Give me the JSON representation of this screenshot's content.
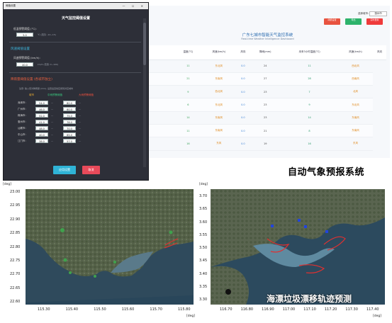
{
  "dashboard": {
    "city_select": {
      "label": "选择城市:",
      "value": "惠州市"
    },
    "buttons": [
      {
        "label": "阈值设置",
        "color": "#e8533f"
      },
      {
        "label": "导出",
        "color": "#2db36b"
      },
      {
        "label": "实时更新",
        "color": "#ef3b3b"
      }
    ],
    "title": "广东七城市智能天气监控系统",
    "subtitle": "Real-time Weather Intelligence Dashboard",
    "columns": [
      "温度(°C)",
      "风速(km/h)",
      "风向",
      "降雨(mm)",
      "未来3小时温度(°C)",
      "风速(km/h)",
      "风向"
    ],
    "rows": [
      [
        "",
        "11",
        "东北风",
        "0.0",
        "24",
        "11",
        "西北风"
      ],
      [
        "",
        "21",
        "东南风",
        "0.0",
        "27",
        "28",
        "西南风"
      ],
      [
        "",
        "9",
        "西北风",
        "0.0",
        "23",
        "7",
        "北风"
      ],
      [
        "",
        "6",
        "东北风",
        "0.0",
        "23",
        "9",
        "东北风"
      ],
      [
        "",
        "14",
        "东南风",
        "0.0",
        "23",
        "14",
        "东南风"
      ],
      [
        "",
        "11",
        "东南风",
        "0.0",
        "21",
        "8",
        "东南风"
      ],
      [
        "",
        "16",
        "东风",
        "0.0",
        "19",
        "16",
        "东风"
      ]
    ]
  },
  "dialog": {
    "window_title": "阈值设置",
    "heading": "天气监控阈值设置",
    "temp_section": {
      "label": "低温预警阈值 (°C):",
      "value": "5.0",
      "hint": "℃ (范围: -10~15)"
    },
    "wind_section": {
      "title": "风速阈值设置",
      "label": "风速预警阈值 (km/h):",
      "value": "40.0",
      "hint": "km/h (范围: 0~100)"
    },
    "color_section": {
      "title": "降雨量阈值设置 (各城市独立)",
      "tip": "注意: 输入值为降雨量 (mm), 设置后自动应用到对应城市",
      "col_city": "城市",
      "col_low": "中雨预警阈值",
      "col_high": "大雨预警阈值",
      "rows": [
        {
          "city": "深圳市:",
          "low": "54.0",
          "high": "80.0"
        },
        {
          "city": "广州市:",
          "low": "46.0",
          "high": "60.0"
        },
        {
          "city": "珠海市:",
          "low": "52.0",
          "high": "75.0"
        },
        {
          "city": "惠州市:",
          "low": "41.0",
          "high": "78.0"
        },
        {
          "city": "汕尾市:",
          "low": "48.0",
          "high": "70.0"
        },
        {
          "city": "中山市:",
          "low": "40.0",
          "high": "65.0"
        },
        {
          "city": "江门市:",
          "low": "38.0",
          "high": "57.0"
        }
      ]
    },
    "apply_button": "应用设置",
    "cancel_button": "取消"
  },
  "caption_top": "自动气象预报系统",
  "map_left": {
    "unit": "[deg]",
    "y_ticks": [
      "23.00",
      "22.95",
      "22.90",
      "22.85",
      "22.80",
      "22.75",
      "22.70",
      "22.65",
      "22.60"
    ],
    "x_ticks": [
      "115.30",
      "115.40",
      "115.50",
      "115.60",
      "115.70",
      "115.80"
    ]
  },
  "map_right": {
    "unit": "[deg]",
    "y_ticks": [
      "3.70",
      "3.65",
      "3.60",
      "3.55",
      "3.50",
      "3.45",
      "3.40",
      "3.35",
      "3.30"
    ],
    "x_ticks": [
      "116.70",
      "116.80",
      "116.90",
      "117.00",
      "117.10",
      "117.20",
      "117.30",
      "117.40"
    ]
  },
  "caption_map": "海漂垃圾漂移轨迹预测",
  "colors": {
    "accent_blue": "#2b6cb0",
    "dialog_bg": "#2d2f38",
    "apply": "#2fb3d6",
    "cancel": "#e84a5a"
  }
}
